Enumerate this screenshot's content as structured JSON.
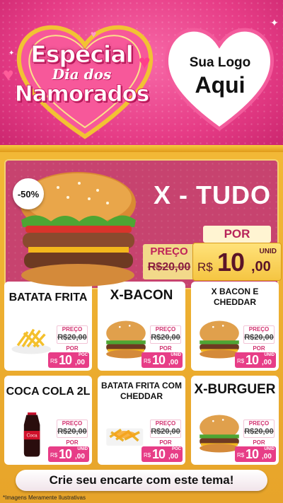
{
  "header": {
    "title_line1": "Especial",
    "title_line2": "Dia dos",
    "title_line3": "Namorados",
    "logo_line1": "Sua Logo",
    "logo_line2": "Aqui"
  },
  "featured": {
    "discount": "-50%",
    "name": "X - TUDO",
    "preco_label": "PREÇO",
    "old_price": "R$20,00",
    "por_label": "POR",
    "currency": "R$",
    "price_int": "10",
    "price_cents": ",00",
    "unit": "UNID"
  },
  "products": [
    {
      "name": "BATATA FRITA",
      "icon": "fries-icon",
      "preco_label": "PREÇO",
      "old_price": "R$20,00",
      "por_label": "POR",
      "currency": "R$",
      "price_int": "10",
      "price_cents": ",00",
      "unit": "POC"
    },
    {
      "name": "X-BACON",
      "icon": "burger-icon",
      "preco_label": "PREÇO",
      "old_price": "R$20,00",
      "por_label": "POR",
      "currency": "R$",
      "price_int": "10",
      "price_cents": ",00",
      "unit": "UNID"
    },
    {
      "name": "X BACON E CHEDDAR",
      "icon": "burger-icon",
      "preco_label": "PREÇO",
      "old_price": "R$20,00",
      "por_label": "POR",
      "currency": "R$",
      "price_int": "10",
      "price_cents": ",00",
      "unit": "UNID"
    },
    {
      "name": "COCA COLA 2L",
      "icon": "soda-bottle-icon",
      "preco_label": "PREÇO",
      "old_price": "R$20,00",
      "por_label": "POR",
      "currency": "R$",
      "price_int": "10",
      "price_cents": ",00",
      "unit": "UNID"
    },
    {
      "name": "BATATA FRITA COM CHEDDAR",
      "icon": "fries-cheddar-icon",
      "preco_label": "PREÇO",
      "old_price": "R$20,00",
      "por_label": "POR",
      "currency": "R$",
      "price_int": "10",
      "price_cents": ",00",
      "unit": "POC"
    },
    {
      "name": "X-BURGUER",
      "icon": "burger-icon",
      "preco_label": "PREÇO",
      "old_price": "R$20,00",
      "por_label": "POR",
      "currency": "R$",
      "price_int": "10",
      "price_cents": ",00",
      "unit": "UNID"
    }
  ],
  "footer": {
    "cta": "Crie seu encarte com este tema!",
    "disclaimer": "*Imagens Meramente Ilustrativas"
  },
  "colors": {
    "pink": "#e73d87",
    "gold": "#f2b836",
    "wine": "#c7436f"
  }
}
